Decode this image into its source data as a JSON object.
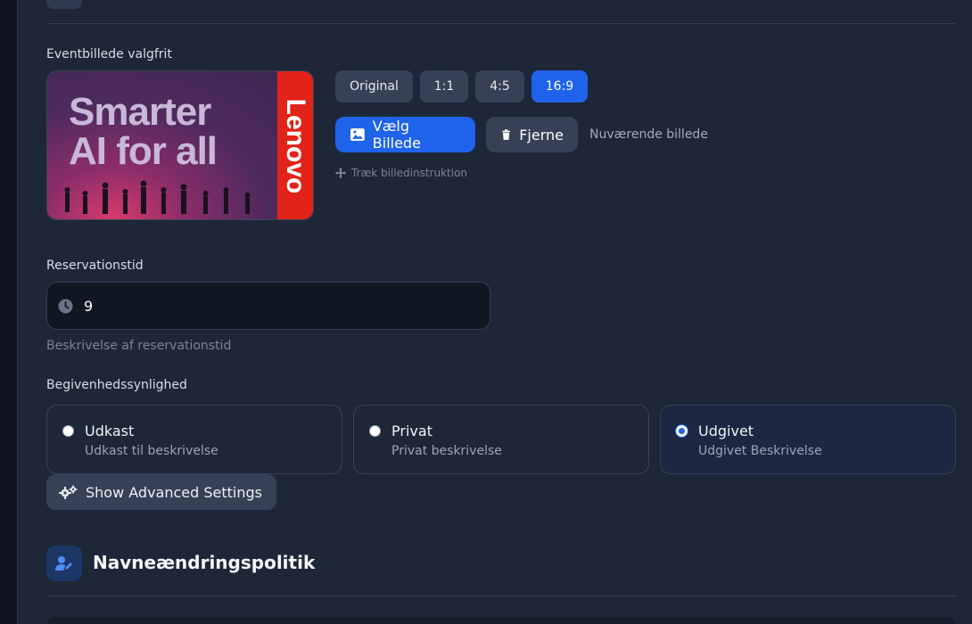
{
  "image_section": {
    "label": "Eventbillede valgfrit",
    "preview": {
      "headline_line1": "Smarter",
      "headline_line2": "AI for all",
      "brand": "Lenovo"
    },
    "ratios": [
      {
        "label": "Original",
        "active": false
      },
      {
        "label": "1:1",
        "active": false
      },
      {
        "label": "4:5",
        "active": false
      },
      {
        "label": "16:9",
        "active": true
      }
    ],
    "choose_button": "Vælg Billede",
    "remove_button": "Fjerne",
    "current_image_text": "Nuværende billede",
    "drag_hint": "Træk billedinstruktion"
  },
  "reservation": {
    "label": "Reservationstid",
    "value": "9",
    "description": "Beskrivelse af reservationstid"
  },
  "visibility": {
    "label": "Begivenhedssynlighed",
    "options": [
      {
        "title": "Udkast",
        "description": "Udkast til beskrivelse",
        "selected": false
      },
      {
        "title": "Privat",
        "description": "Privat beskrivelse",
        "selected": false
      },
      {
        "title": "Udgivet",
        "description": "Udgivet Beskrivelse",
        "selected": true
      }
    ]
  },
  "advanced_button": "Show Advanced Settings",
  "name_change_section": {
    "title": "Navneændringspolitik"
  },
  "colors": {
    "accent": "#1f63ea",
    "background": "#1e2738",
    "input_bg": "#101622"
  }
}
